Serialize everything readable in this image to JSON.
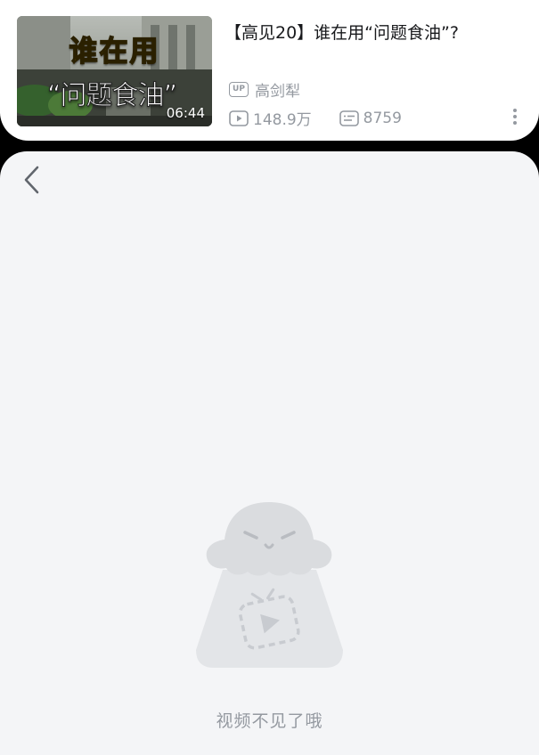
{
  "video": {
    "title": "【高见20】谁在用“问题食油”?",
    "thumbnail_text_top": "谁在用",
    "thumbnail_text_bottom": "“问题食油”",
    "duration": "06:44",
    "up_badge": "UP",
    "uploader": "高剑犁",
    "views": "148.9万",
    "danmaku": "8759",
    "more_icon": "more-vertical-icon"
  },
  "player": {
    "back_icon": "chevron-left-icon",
    "empty_message": "视频不见了哦",
    "empty_icon": "missing-video-mascot"
  },
  "colors": {
    "card_bg": "#ffffff",
    "panel_bg": "#f4f5f7",
    "text_primary": "#18191c",
    "text_secondary": "#9499a0",
    "thumbnail_yellow": "#ffd21e",
    "mascot_gray": "#dfe1e5"
  }
}
